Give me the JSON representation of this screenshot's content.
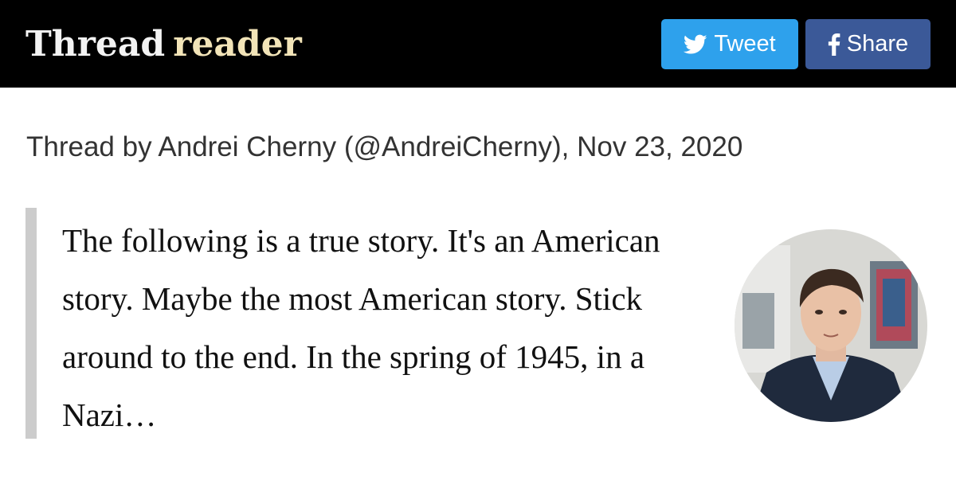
{
  "header": {
    "logo_word1": "Thread",
    "logo_word2": "reader",
    "tweet_label": "Tweet",
    "share_label": "Share"
  },
  "thread": {
    "byline": "Thread by Andrei Cherny (@AndreiCherny), Nov 23, 2020",
    "excerpt": "The following is a true story. It's an American story. Maybe the most American story. Stick around to the end. In the spring of 1945, in a Nazi…"
  },
  "colors": {
    "header_bg": "#000000",
    "tweet_button": "#2ea1ec",
    "share_button": "#3b5998",
    "logo_accent": "#f2e4b8",
    "quote_bar": "#cccccc"
  },
  "icons": {
    "tweet": "twitter-bird-icon",
    "share": "facebook-f-icon"
  }
}
